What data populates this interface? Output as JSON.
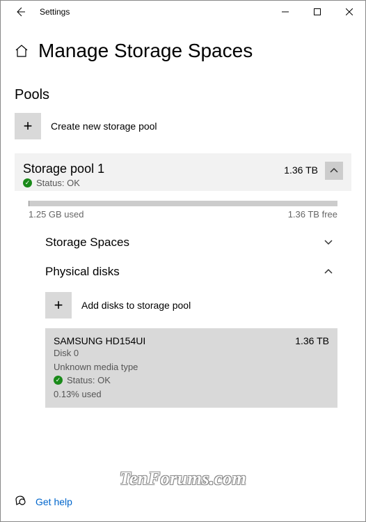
{
  "window": {
    "title": "Settings"
  },
  "page": {
    "title": "Manage Storage Spaces"
  },
  "pools": {
    "heading": "Pools",
    "create_label": "Create new storage pool"
  },
  "pool": {
    "name": "Storage pool 1",
    "status_label": "Status: OK",
    "size": "1.36 TB",
    "used": "1.25 GB used",
    "free": "1.36 TB free"
  },
  "subsections": {
    "spaces": "Storage Spaces",
    "disks": "Physical disks",
    "add_disks": "Add disks to storage pool"
  },
  "disk": {
    "name": "SAMSUNG HD154UI",
    "size": "1.36 TB",
    "id": "Disk 0",
    "media": "Unknown media type",
    "status": "Status: OK",
    "used": "0.13% used"
  },
  "help": {
    "label": "Get help"
  },
  "watermark": "TenForums.com"
}
